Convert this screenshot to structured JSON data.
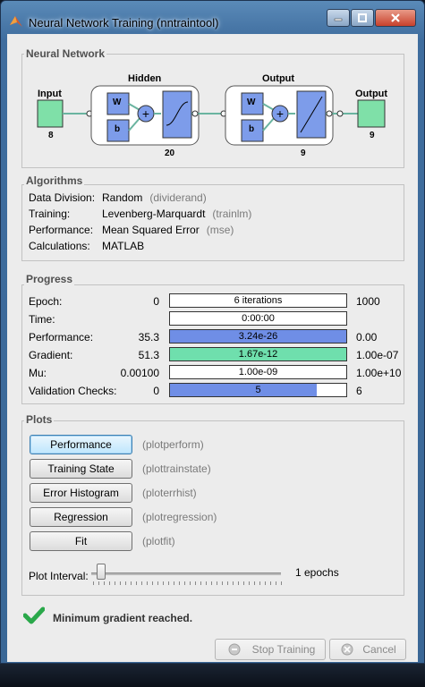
{
  "window": {
    "title": "Neural Network Training (nntraintool)"
  },
  "network": {
    "section_title": "Neural Network",
    "input_label": "Input",
    "input_size": "8",
    "hidden_label": "Hidden",
    "hidden_size": "20",
    "output_layer_label": "Output",
    "output_layer_size": "9",
    "output_label": "Output",
    "output_size": "9",
    "w": "W",
    "b": "b"
  },
  "algorithms": {
    "section_title": "Algorithms",
    "rows": [
      {
        "label": "Data Division:",
        "value": "Random",
        "func": "(dividerand)"
      },
      {
        "label": "Training:",
        "value": "Levenberg-Marquardt",
        "func": "(trainlm)"
      },
      {
        "label": "Performance:",
        "value": "Mean Squared Error",
        "func": "(mse)"
      },
      {
        "label": "Calculations:",
        "value": "MATLAB",
        "func": ""
      }
    ]
  },
  "progress": {
    "section_title": "Progress",
    "rows": [
      {
        "label": "Epoch:",
        "start": "0",
        "bar_text": "6 iterations",
        "end": "1000",
        "fill_fraction": 0,
        "fill_color": "#6f8ee6"
      },
      {
        "label": "Time:",
        "start": "",
        "bar_text": "0:00:00",
        "end": "",
        "fill_fraction": 0,
        "fill_color": "#6f8ee6"
      },
      {
        "label": "Performance:",
        "start": "35.3",
        "bar_text": "3.24e-26",
        "end": "0.00",
        "fill_fraction": 1,
        "fill_color": "#6f8ee6"
      },
      {
        "label": "Gradient:",
        "start": "51.3",
        "bar_text": "1.67e-12",
        "end": "1.00e-07",
        "fill_fraction": 1,
        "fill_color": "#6fdfad"
      },
      {
        "label": "Mu:",
        "start": "0.00100",
        "bar_text": "1.00e-09",
        "end": "1.00e+10",
        "fill_fraction": 0,
        "fill_color": "#6f8ee6"
      },
      {
        "label": "Validation Checks:",
        "start": "0",
        "bar_text": "5",
        "end": "6",
        "fill_fraction": 0.833,
        "fill_color": "#6f8ee6"
      }
    ]
  },
  "plots": {
    "section_title": "Plots",
    "buttons": [
      {
        "label": "Performance",
        "func": "(plotperform)"
      },
      {
        "label": "Training State",
        "func": "(plottrainstate)"
      },
      {
        "label": "Error Histogram",
        "func": "(ploterrhist)"
      },
      {
        "label": "Regression",
        "func": "(plotregression)"
      },
      {
        "label": "Fit",
        "func": "(plotfit)"
      }
    ],
    "interval_label": "Plot Interval:",
    "interval_value": "1 epochs"
  },
  "status": {
    "icon": "check-icon",
    "message": "Minimum gradient reached."
  },
  "footer": {
    "stop_label": "Stop Training",
    "cancel_label": "Cancel"
  },
  "colors": {
    "accent_blue": "#6f8ee6",
    "accent_green": "#6fdfad",
    "neuron_green": "#7fe0a8"
  }
}
